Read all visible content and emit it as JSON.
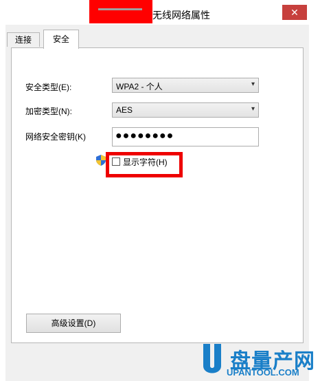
{
  "window": {
    "title": "无线网络属性",
    "close_label": "✕"
  },
  "tabs": [
    {
      "label": "连接",
      "active": false
    },
    {
      "label": "安全",
      "active": true
    }
  ],
  "form": {
    "security_type_label": "安全类型(E):",
    "security_type_value": "WPA2 - 个人",
    "encryption_type_label": "加密类型(N):",
    "encryption_type_value": "AES",
    "network_key_label": "网络安全密钥(K)",
    "network_key_value": "●●●●●●●●",
    "show_characters_label": "显示字符(H)",
    "show_characters_checked": false
  },
  "buttons": {
    "advanced_label": "高级设置(D)"
  },
  "watermark": {
    "brand": "盘量产网",
    "url": "UPANTOOL.COM",
    "accent_color": "#1a7fc8"
  },
  "colors": {
    "close_button": "#c7403d",
    "highlight_box": "#ee0000"
  }
}
